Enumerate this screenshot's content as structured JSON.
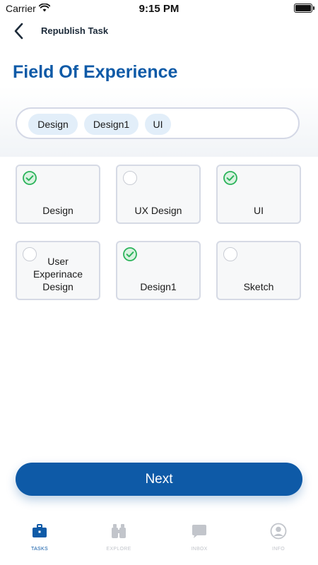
{
  "status_bar": {
    "carrier": "Carrier",
    "time": "9:15 PM"
  },
  "nav": {
    "title": "Republish Task"
  },
  "page": {
    "title": "Field Of Experience"
  },
  "selected_chips": [
    "Design",
    "Design1",
    "UI"
  ],
  "options": [
    {
      "label": "Design",
      "checked": true
    },
    {
      "label": "UX Design",
      "checked": false
    },
    {
      "label": "UI",
      "checked": true
    },
    {
      "label": "User Experinace Design",
      "checked": false
    },
    {
      "label": "Design1",
      "checked": true
    },
    {
      "label": "Sketch",
      "checked": false
    }
  ],
  "next_button": {
    "label": "Next"
  },
  "tab_bar": [
    {
      "label": "TASKS",
      "icon": "briefcase-icon",
      "active": true
    },
    {
      "label": "EXPLORE",
      "icon": "binoculars-icon",
      "active": false
    },
    {
      "label": "INBOX",
      "icon": "chat-bubble-icon",
      "active": false
    },
    {
      "label": "INFO",
      "icon": "user-circle-icon",
      "active": false
    }
  ],
  "colors": {
    "primary": "#0e5aa7",
    "check_green": "#2bb35a",
    "chip_bg": "#e2eef9",
    "tab_inactive": "#c2c5cb"
  }
}
